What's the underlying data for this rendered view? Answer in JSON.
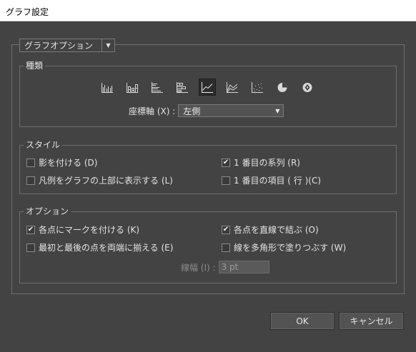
{
  "window": {
    "title": "グラフ設定"
  },
  "options_dropdown": {
    "value": "グラフオプション"
  },
  "chart_types_group": {
    "legend": "種類",
    "icons": [
      {
        "name": "grouped-column-chart-icon",
        "selected": false
      },
      {
        "name": "stacked-column-chart-icon",
        "selected": false
      },
      {
        "name": "grouped-bar-chart-icon",
        "selected": false
      },
      {
        "name": "stacked-bar-chart-icon",
        "selected": false
      },
      {
        "name": "line-chart-icon",
        "selected": true
      },
      {
        "name": "area-chart-icon",
        "selected": false
      },
      {
        "name": "scatter-chart-icon",
        "selected": false
      },
      {
        "name": "pie-chart-icon",
        "selected": false
      },
      {
        "name": "radar-chart-icon",
        "selected": false
      }
    ],
    "axis_label": "座標軸 (X) :",
    "axis_value": "左側"
  },
  "style_group": {
    "legend": "スタイル",
    "items": [
      {
        "label": "影を付ける (D)",
        "checked": false
      },
      {
        "label": "1 番目の系列 (R)",
        "checked": true
      },
      {
        "label": "凡例をグラフの上部に表示する (L)",
        "checked": false
      },
      {
        "label": "1 番目の項目 ( 行 )(C)",
        "checked": false
      }
    ]
  },
  "options_group": {
    "legend": "オプション",
    "items": [
      {
        "label": "各点にマークを付ける (K)",
        "checked": true
      },
      {
        "label": "各点を直線で結ぶ (O)",
        "checked": true
      },
      {
        "label": "最初と最後の点を両端に揃える (E)",
        "checked": false
      },
      {
        "label": "線を多角形で塗りつぶす (W)",
        "checked": false
      }
    ],
    "stroke_label": "線幅 (I) :",
    "stroke_value": "3 pt"
  },
  "buttons": {
    "ok": "OK",
    "cancel": "キャンセル"
  },
  "colors": {
    "background": "#434343",
    "frame": "#6e6e6e",
    "text": "#e4e4e4"
  }
}
